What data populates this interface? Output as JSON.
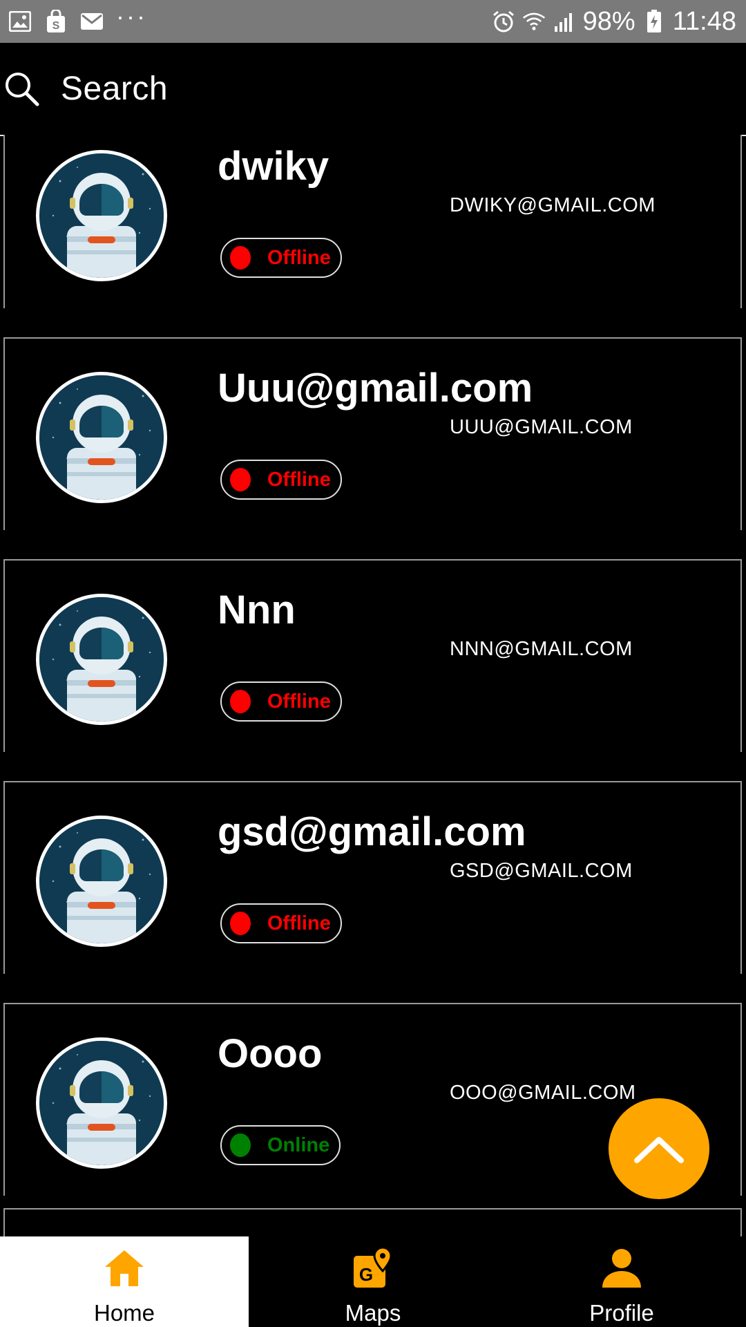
{
  "status_bar": {
    "battery": "98%",
    "time": "11:48",
    "icons": [
      "image-icon",
      "shopping-bag-icon",
      "mail-icon",
      "more-dots-icon",
      "alarm-icon",
      "wifi-icon",
      "signal-icon",
      "battery-charging-icon"
    ]
  },
  "search": {
    "placeholder": "Search"
  },
  "users": [
    {
      "name": "dwiky",
      "email": "DWIKY@GMAIL.COM",
      "status": "Offline"
    },
    {
      "name": "Uuu@gmail.com",
      "email": "UUU@GMAIL.COM",
      "status": "Offline"
    },
    {
      "name": "Nnn",
      "email": "NNN@GMAIL.COM",
      "status": "Offline"
    },
    {
      "name": "gsd@gmail.com",
      "email": "GSD@GMAIL.COM",
      "status": "Offline"
    },
    {
      "name": "Oooo",
      "email": "OOO@GMAIL.COM",
      "status": "Online"
    }
  ],
  "status_colors": {
    "Offline": "#ff0000",
    "Online": "#008000"
  },
  "fab": {
    "icon": "chevron-up-icon",
    "color": "#ffa500"
  },
  "nav": {
    "accent": "#ffa500",
    "items": [
      {
        "label": "Home",
        "icon": "home-icon",
        "active": true
      },
      {
        "label": "Maps",
        "icon": "maps-icon",
        "active": false
      },
      {
        "label": "Profile",
        "icon": "profile-icon",
        "active": false
      }
    ]
  }
}
